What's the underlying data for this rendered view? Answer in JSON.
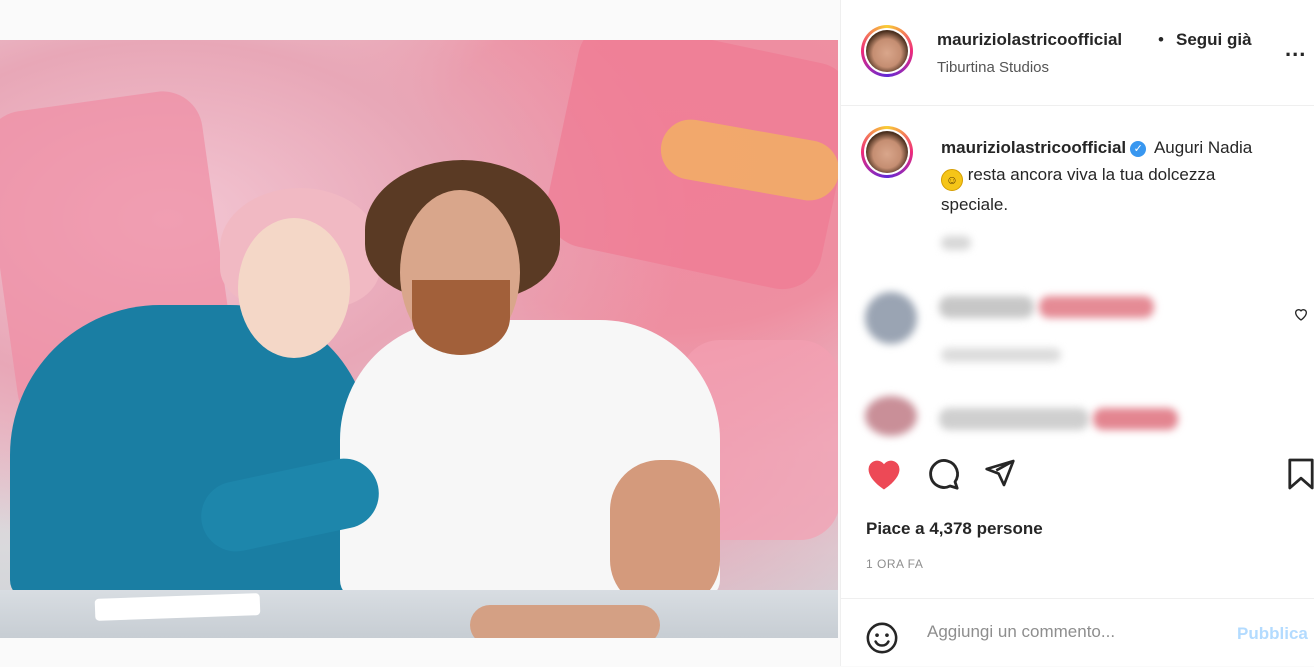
{
  "post": {
    "image_alt": "Foto di Nadia e Maurizio Lastrico in studio"
  },
  "header": {
    "username": "mauriziolastricoofficial",
    "separator": "•",
    "follow_label": "Segui già",
    "location": "Tiburtina Studios",
    "more_icon": "more-horizontal-icon",
    "more_label": "..."
  },
  "caption": {
    "username": "mauriziolastricoofficial",
    "verified_icon": "verified-badge-icon",
    "verified_glyph": "✓",
    "text_part1": "Auguri Nadia",
    "emoji": "smile",
    "emoji_glyph": "☺",
    "text_part2": "resta ancora viva la tua dolcezza speciale."
  },
  "actions": {
    "like_icon": "heart-filled-icon",
    "comment_icon": "comment-icon",
    "share_icon": "share-icon",
    "save_icon": "bookmark-icon",
    "liked_color": "#ed4956"
  },
  "likes": {
    "text": "Piace a 4,378 persone"
  },
  "timestamp": {
    "text": "1 ORA FA"
  },
  "comment_box": {
    "emoji_icon": "emoji-smile-icon",
    "placeholder": "Aggiungi un commento...",
    "publish_label": "Pubblica",
    "publish_color": "#b3dbff"
  },
  "colors": {
    "verified": "#3897f0",
    "text_primary": "#262626",
    "text_secondary": "#8e8e8e"
  }
}
